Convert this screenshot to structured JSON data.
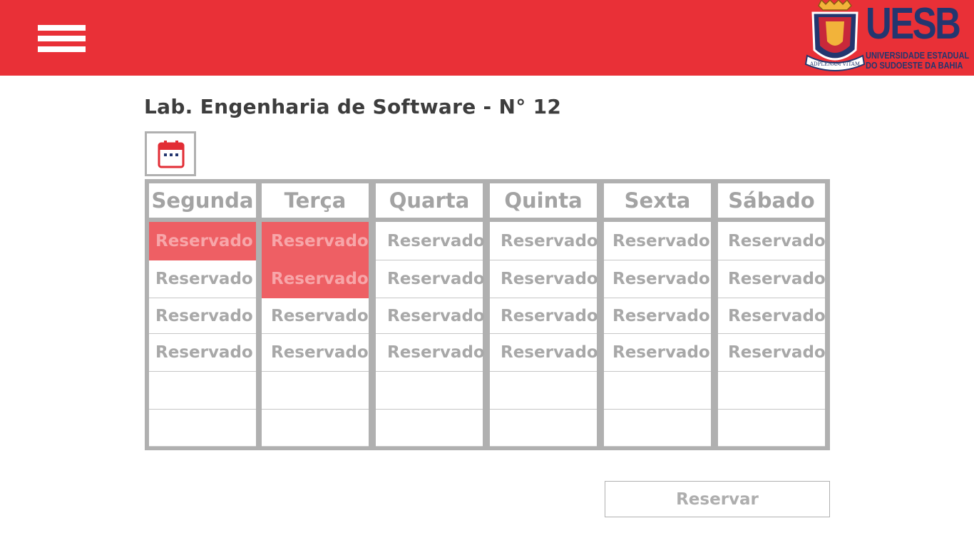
{
  "app": {
    "menu_icon": "hamburger-menu-icon",
    "colors": {
      "header": "#e93037",
      "reserved_slot": "#ee5f64",
      "grid": "#b0b0b0",
      "logo": "#23366f"
    }
  },
  "logo": {
    "name": "UESB",
    "subtitle_line1": "UNIVERSIDADE ESTADUAL",
    "subtitle_line2": "DO SUDOESTE DA BAHIA",
    "motto": "ADPLENAM VITAM",
    "icon": "university-crest-icon"
  },
  "page": {
    "title": "Lab. Engenharia de Software - N° 12",
    "calendar_icon": "calendar-icon"
  },
  "schedule": {
    "days": [
      {
        "name": "Segunda",
        "slots": [
          {
            "text": "Reservado",
            "selected": true
          },
          {
            "text": "Reservado",
            "selected": false
          },
          {
            "text": "Reservado",
            "selected": false
          },
          {
            "text": "Reservado",
            "selected": false
          },
          {
            "text": "",
            "selected": false
          },
          {
            "text": "",
            "selected": false
          }
        ]
      },
      {
        "name": "Terça",
        "slots": [
          {
            "text": "Reservado",
            "selected": true
          },
          {
            "text": "Reservado",
            "selected": true
          },
          {
            "text": "Reservado",
            "selected": false
          },
          {
            "text": "Reservado",
            "selected": false
          },
          {
            "text": "",
            "selected": false
          },
          {
            "text": "",
            "selected": false
          }
        ]
      },
      {
        "name": "Quarta",
        "slots": [
          {
            "text": "Reservado",
            "selected": false
          },
          {
            "text": "Reservado",
            "selected": false
          },
          {
            "text": "Reservado",
            "selected": false
          },
          {
            "text": "Reservado",
            "selected": false
          },
          {
            "text": "",
            "selected": false
          },
          {
            "text": "",
            "selected": false
          }
        ]
      },
      {
        "name": "Quinta",
        "slots": [
          {
            "text": "Reservado",
            "selected": false
          },
          {
            "text": "Reservado",
            "selected": false
          },
          {
            "text": "Reservado",
            "selected": false
          },
          {
            "text": "Reservado",
            "selected": false
          },
          {
            "text": "",
            "selected": false
          },
          {
            "text": "",
            "selected": false
          }
        ]
      },
      {
        "name": "Sexta",
        "slots": [
          {
            "text": "Reservado",
            "selected": false
          },
          {
            "text": "Reservado",
            "selected": false
          },
          {
            "text": "Reservado",
            "selected": false
          },
          {
            "text": "Reservado",
            "selected": false
          },
          {
            "text": "",
            "selected": false
          },
          {
            "text": "",
            "selected": false
          }
        ]
      },
      {
        "name": "Sábado",
        "slots": [
          {
            "text": "Reservado",
            "selected": false
          },
          {
            "text": "Reservado",
            "selected": false
          },
          {
            "text": "Reservado",
            "selected": false
          },
          {
            "text": "Reservado",
            "selected": false
          },
          {
            "text": "",
            "selected": false
          },
          {
            "text": "",
            "selected": false
          }
        ]
      }
    ]
  },
  "actions": {
    "reserve_label": "Reservar"
  }
}
